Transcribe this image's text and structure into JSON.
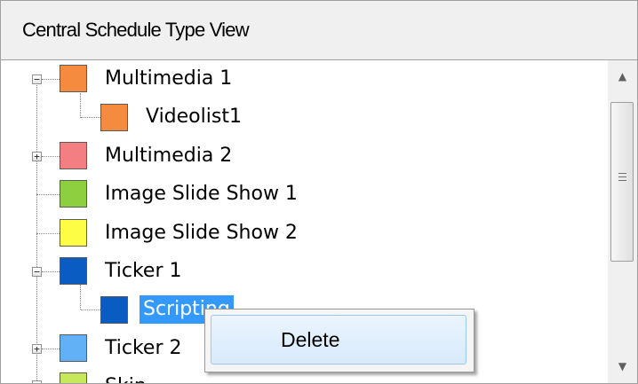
{
  "header": {
    "title": "Central Schedule Type View"
  },
  "tree": {
    "nodes": [
      {
        "label": "Multimedia 1",
        "color": "#f58b3e",
        "expander": "minus",
        "selected": false
      },
      {
        "label": "Videolist1",
        "color": "#f58b3e",
        "expander": "",
        "selected": false
      },
      {
        "label": "Multimedia 2",
        "color": "#f47f82",
        "expander": "plus",
        "selected": false
      },
      {
        "label": "Image Slide Show 1",
        "color": "#8ecf3f",
        "expander": "",
        "selected": false
      },
      {
        "label": "Image Slide Show 2",
        "color": "#fdfd46",
        "expander": "",
        "selected": false
      },
      {
        "label": "Ticker 1",
        "color": "#0a5bc2",
        "expander": "minus",
        "selected": false
      },
      {
        "label": "Scripting",
        "color": "#0a5bc2",
        "expander": "",
        "selected": true
      },
      {
        "label": "Ticker 2",
        "color": "#62b0f5",
        "expander": "plus",
        "selected": false
      },
      {
        "label": "Skin",
        "color": "#c6e85a",
        "expander": "plus",
        "selected": false
      }
    ],
    "expander_glyphs": {
      "minus": "−",
      "plus": "+"
    }
  },
  "scrollbar": {
    "up_glyph": "▲",
    "down_glyph": "▼"
  },
  "context_menu": {
    "items": [
      {
        "label": "Delete"
      }
    ]
  }
}
